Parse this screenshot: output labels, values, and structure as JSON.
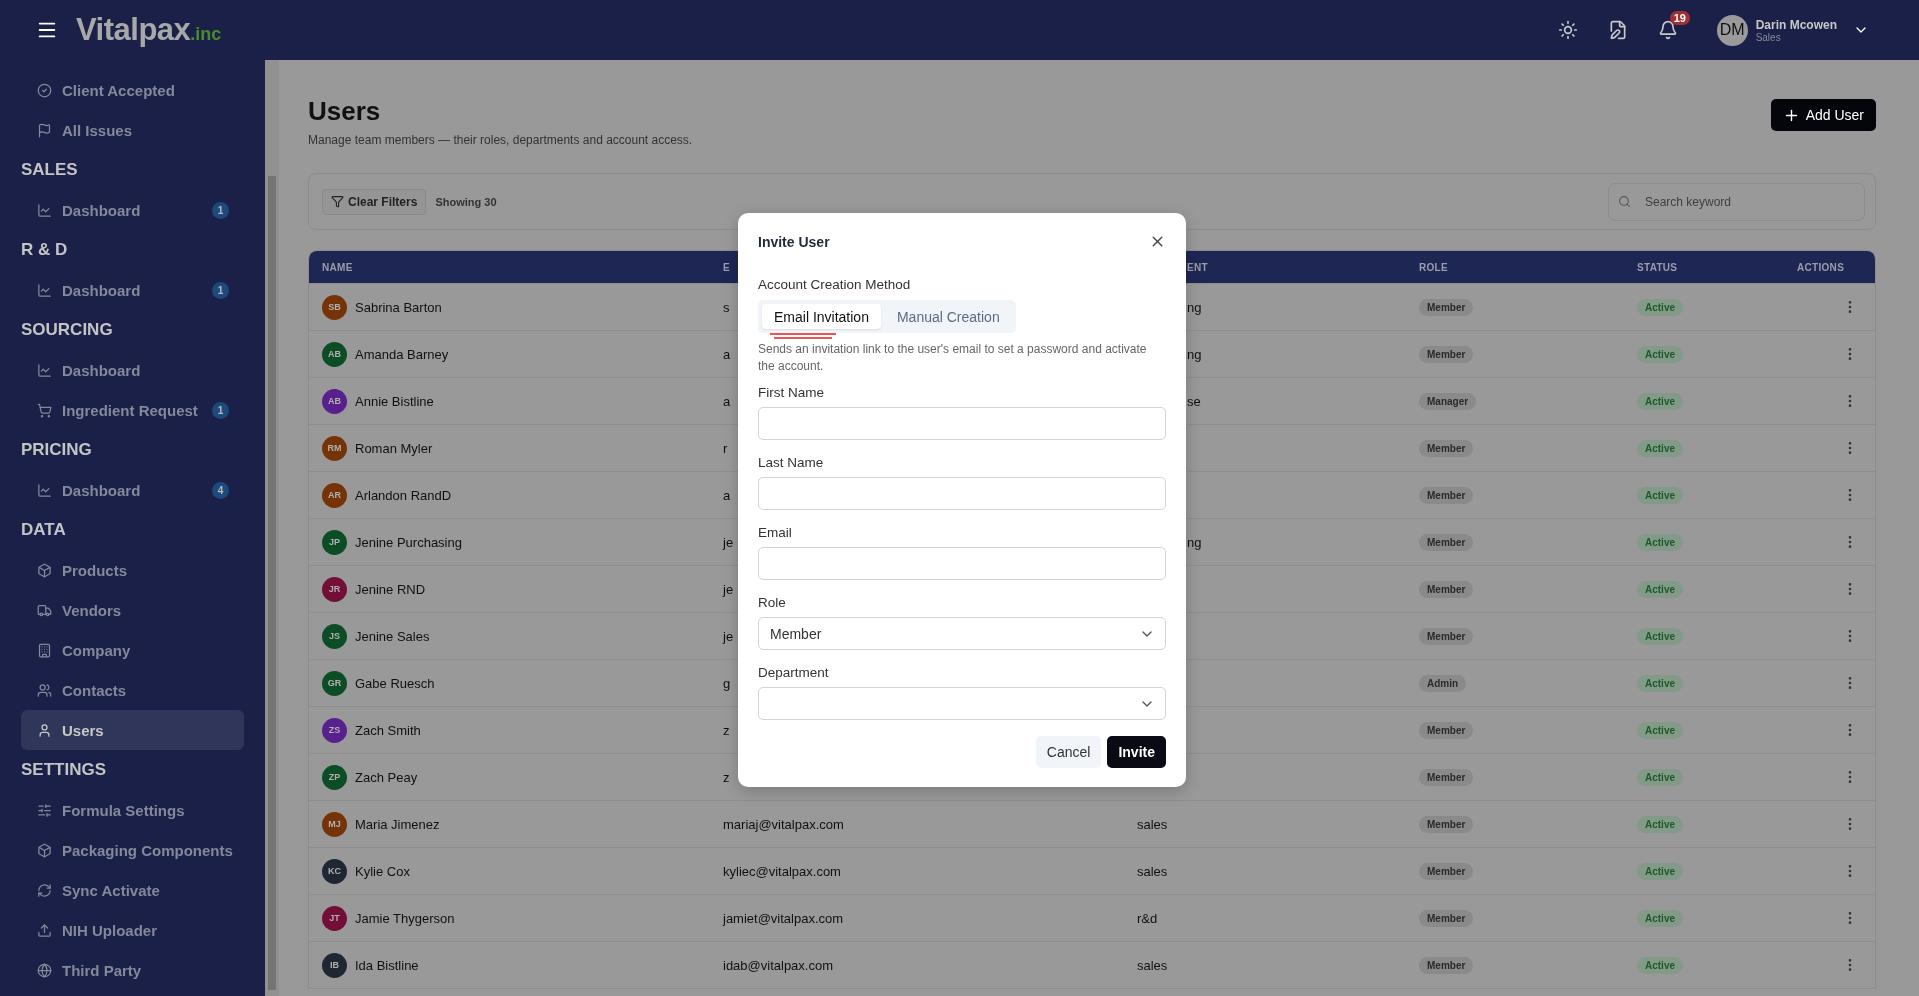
{
  "header": {
    "logo": {
      "name": "Vitalpax",
      "suffix": ".inc"
    },
    "notifications": "19",
    "user": {
      "initials": "DM",
      "name": "Darin Mcowen",
      "role": "Sales"
    }
  },
  "sidebar": {
    "groups": [
      {
        "items": [
          {
            "label": "Client Accepted",
            "selected": false
          },
          {
            "label": "All Issues",
            "selected": false
          }
        ]
      },
      {
        "title": "SALES",
        "items": [
          {
            "label": "Dashboard",
            "badge": "1",
            "selected": false
          }
        ]
      },
      {
        "title": "R & D",
        "items": [
          {
            "label": "Dashboard",
            "badge": "1",
            "selected": false
          }
        ]
      },
      {
        "title": "SOURCING",
        "items": [
          {
            "label": "Dashboard",
            "selected": false
          },
          {
            "label": "Ingredient Request",
            "badge": "1",
            "selected": false
          }
        ]
      },
      {
        "title": "PRICING",
        "items": [
          {
            "label": "Dashboard",
            "badge": "4",
            "selected": false
          }
        ]
      },
      {
        "title": "DATA",
        "items": [
          {
            "label": "Products",
            "selected": false
          },
          {
            "label": "Vendors",
            "selected": false
          },
          {
            "label": "Company",
            "selected": false
          },
          {
            "label": "Contacts",
            "selected": false
          },
          {
            "label": "Users",
            "selected": true
          }
        ]
      },
      {
        "title": "SETTINGS",
        "items": [
          {
            "label": "Formula Settings",
            "selected": false
          },
          {
            "label": "Packaging Components",
            "selected": false
          },
          {
            "label": "Sync Activate",
            "selected": false
          },
          {
            "label": "NIH Uploader",
            "selected": false
          },
          {
            "label": "Third Party",
            "selected": false
          }
        ]
      }
    ]
  },
  "page": {
    "title": "Users",
    "subtitle": "Manage team members — their roles, departments and account access.",
    "add_button": "Add User"
  },
  "filters": {
    "clear_button": "Clear Filters",
    "count": "Showing 30",
    "search": {
      "placeholder": "Search keyword"
    }
  },
  "table": {
    "columns": [
      "NAME",
      "E",
      "ENT",
      "ROLE",
      "STATUS",
      "ACTIONS"
    ],
    "rows": [
      {
        "initials": "SB",
        "color": "#743407",
        "name": "Sabrina Barton",
        "email": "s",
        "department": "ng",
        "role": "Member",
        "status": "Active"
      },
      {
        "initials": "AB",
        "color": "#0d4d25",
        "name": "Amanda Barney",
        "email": "a",
        "department": "ng",
        "role": "Member",
        "status": "Active"
      },
      {
        "initials": "AB",
        "color": "#58208c",
        "name": "Annie Bistline",
        "email": "a",
        "department": "se",
        "role": "Manager",
        "status": "Active"
      },
      {
        "initials": "RM",
        "color": "#743407",
        "name": "Roman Myler",
        "email": "r",
        "role": "Member",
        "status": "Active"
      },
      {
        "initials": "AR",
        "color": "#743407",
        "name": "Arlandon RandD",
        "email": "a",
        "role": "Member",
        "status": "Active"
      },
      {
        "initials": "JP",
        "color": "#0d4d25",
        "name": "Jenine Purchasing",
        "email": "je",
        "department": "ng",
        "role": "Member",
        "status": "Active"
      },
      {
        "initials": "JR",
        "color": "#720e38",
        "name": "Jenine RND",
        "email": "je",
        "role": "Member",
        "status": "Active"
      },
      {
        "initials": "JS",
        "color": "#0d4d25",
        "name": "Jenine Sales",
        "email": "je",
        "role": "Member",
        "status": "Active"
      },
      {
        "initials": "GR",
        "color": "#0d4d25",
        "name": "Gabe Ruesch",
        "email": "g",
        "role": "Admin",
        "status": "Active"
      },
      {
        "initials": "ZS",
        "color": "#58208c",
        "name": "Zach Smith",
        "email": "z",
        "role": "Member",
        "status": "Active"
      },
      {
        "initials": "ZP",
        "color": "#0d4d25",
        "name": "Zach Peay",
        "email": "z",
        "role": "Member",
        "status": "Active"
      },
      {
        "initials": "MJ",
        "color": "#743407",
        "name": "Maria Jimenez",
        "email": "mariaj@vitalpax.com",
        "department": "sales",
        "role": "Member",
        "status": "Active"
      },
      {
        "initials": "KC",
        "color": "#1f2733",
        "name": "Kylie Cox",
        "email": "kyliec@vitalpax.com",
        "department": "sales",
        "role": "Member",
        "status": "Active"
      },
      {
        "initials": "JT",
        "color": "#720e38",
        "name": "Jamie Thygerson",
        "email": "jamiet@vitalpax.com",
        "department": "r&d",
        "role": "Member",
        "status": "Active"
      },
      {
        "initials": "IB",
        "color": "#1f2733",
        "name": "Ida Bistline",
        "email": "idab@vitalpax.com",
        "department": "sales",
        "role": "Member",
        "status": "Active"
      }
    ]
  },
  "modal": {
    "title": "Invite User",
    "method_label": "Account Creation Method",
    "methods": [
      {
        "label": "Email Invitation",
        "selected": true
      },
      {
        "label": "Manual Creation",
        "selected": false
      }
    ],
    "help": "Sends an invitation link to the user's email to set a password and activate the account.",
    "fields": [
      {
        "label": "First Name",
        "kind": "text"
      },
      {
        "label": "Last Name",
        "kind": "text"
      },
      {
        "label": "Email",
        "kind": "text"
      },
      {
        "label": "Role",
        "kind": "select",
        "value": "Member"
      },
      {
        "label": "Department",
        "kind": "select"
      }
    ],
    "cancel": "Cancel",
    "submit": "Invite"
  }
}
